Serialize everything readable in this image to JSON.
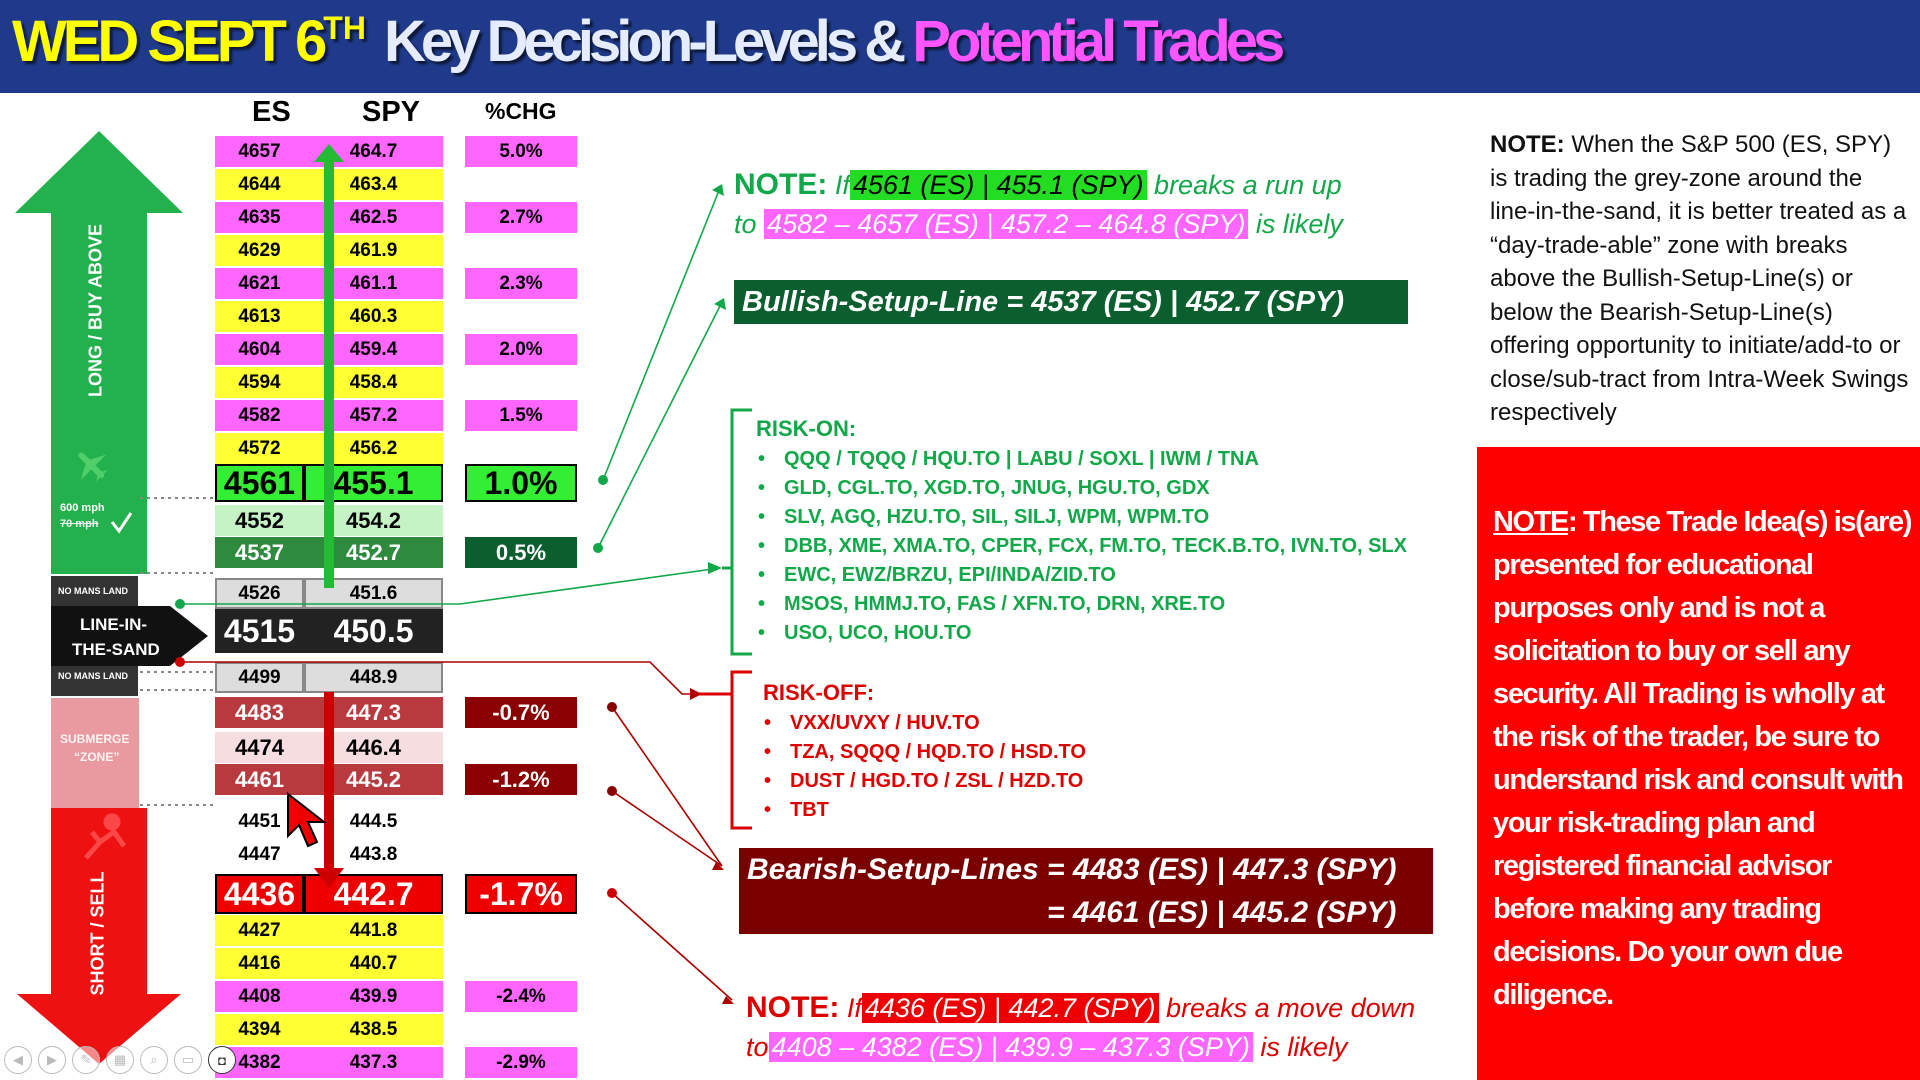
{
  "header": {
    "date": "WED SEPT 6",
    "date_suffix": "TH",
    "title_white": "Key Decision-Levels & ",
    "title_pink": "Potential Trades"
  },
  "columns": {
    "es": "ES",
    "spy": "SPY",
    "pct": "%CHG"
  },
  "rows": [
    {
      "es": "4657",
      "spy": "464.7",
      "pct": "5.0%"
    },
    {
      "es": "4644",
      "spy": "463.4",
      "pct": ""
    },
    {
      "es": "4635",
      "spy": "462.5",
      "pct": "2.7%"
    },
    {
      "es": "4629",
      "spy": "461.9",
      "pct": ""
    },
    {
      "es": "4621",
      "spy": "461.1",
      "pct": "2.3%"
    },
    {
      "es": "4613",
      "spy": "460.3",
      "pct": ""
    },
    {
      "es": "4604",
      "spy": "459.4",
      "pct": "2.0%"
    },
    {
      "es": "4594",
      "spy": "458.4",
      "pct": ""
    },
    {
      "es": "4582",
      "spy": "457.2",
      "pct": "1.5%"
    },
    {
      "es": "4572",
      "spy": "456.2",
      "pct": ""
    },
    {
      "es": "4561",
      "spy": "455.1",
      "pct": "1.0%"
    },
    {
      "es": "4552",
      "spy": "454.2",
      "pct": ""
    },
    {
      "es": "4537",
      "spy": "452.7",
      "pct": "0.5%"
    },
    {
      "es": "4526",
      "spy": "451.6",
      "pct": ""
    },
    {
      "es": "4515",
      "spy": "450.5",
      "pct": ""
    },
    {
      "es": "4499",
      "spy": "448.9",
      "pct": ""
    },
    {
      "es": "4483",
      "spy": "447.3",
      "pct": "-0.7%"
    },
    {
      "es": "4474",
      "spy": "446.4",
      "pct": ""
    },
    {
      "es": "4461",
      "spy": "445.2",
      "pct": "-1.2%"
    },
    {
      "es": "4451",
      "spy": "444.5",
      "pct": ""
    },
    {
      "es": "4447",
      "spy": "443.8",
      "pct": ""
    },
    {
      "es": "4436",
      "spy": "442.7",
      "pct": "-1.7%"
    },
    {
      "es": "4427",
      "spy": "441.8",
      "pct": ""
    },
    {
      "es": "4416",
      "spy": "440.7",
      "pct": ""
    },
    {
      "es": "4408",
      "spy": "439.9",
      "pct": "-2.4%"
    },
    {
      "es": "4394",
      "spy": "438.5",
      "pct": ""
    },
    {
      "es": "4382",
      "spy": "437.3",
      "pct": "-2.9%"
    }
  ],
  "side": {
    "long_label": "LONG / BUY ABOVE",
    "short_label": "SHORT / SELL",
    "speed_new": "600 mph",
    "speed_old": "70 mph",
    "no_mans_land": "NO MANS LAND",
    "line_in_sand_1": "LINE-IN-",
    "line_in_sand_2": "THE-SAND",
    "submerge_1": "SUBMERGE",
    "submerge_2": "“ZONE”"
  },
  "bull_note": {
    "label": "NOTE:",
    "if": "If",
    "level": "4561 (ES) | 455.1 (SPY)",
    "mid": "breaks a run up",
    "to": "to",
    "range": "4582 – 4657 (ES) | 457.2 – 464.8 (SPY)",
    "end": "is likely"
  },
  "bullish_setup": "Bullish-Setup-Line = 4537 (ES) | 452.7   (SPY)",
  "risk_on": {
    "title": "RISK-ON:",
    "items": [
      "QQQ / TQQQ / HQU.TO  |  LABU / SOXL | IWM / TNA",
      "GLD, CGL.TO, XGD.TO, JNUG, HGU.TO, GDX",
      "SLV, AGQ, HZU.TO, SIL, SILJ, WPM, WPM.TO",
      "DBB, XME, XMA.TO, CPER, FCX, FM.TO, TECK.B.TO, IVN.TO, SLX",
      "EWC, EWZ/BRZU, EPI/INDA/ZID.TO",
      "MSOS, HMMJ.TO, FAS / XFN.TO, DRN, XRE.TO",
      "USO, UCO, HOU.TO"
    ]
  },
  "risk_off": {
    "title": "RISK-OFF:",
    "items": [
      "VXX/UVXY / HUV.TO",
      "TZA, SQQQ / HQD.TO / HSD.TO",
      "DUST / HGD.TO / ZSL / HZD.TO",
      "TBT"
    ]
  },
  "bearish_setup": {
    "line1": "Bearish-Setup-Lines = 4483 (ES) | 447.3 (SPY)",
    "line2": "= 4461 (ES) | 445.2  (SPY)"
  },
  "bear_note": {
    "label": "NOTE:",
    "if": "If",
    "level": "4436 (ES) | 442.7 (SPY)",
    "mid": "breaks a move down",
    "to": "to",
    "range": "4408 – 4382 (ES) | 439.9 – 437.3 (SPY)",
    "end": "is likely"
  },
  "right_note": {
    "label": "NOTE:",
    "text": "When the S&P 500 (ES, SPY) is trading the grey-zone around the line-in-the-sand, it is better treated as a “day-trade-able” zone with breaks above the Bullish-Setup-Line(s) or below the Bearish-Setup-Line(s) offering opportunity to initiate/add-to or close/sub-tract from Intra-Week Swings respectively"
  },
  "disclaimer": {
    "label": "NOTE",
    "text": ": These Trade Idea(s) is(are) presented for educational purposes only and is not a solicitation to buy or sell any security. All Trading is wholly at the risk of the trader, be sure to understand risk and consult with your risk-trading plan and registered financial advisor before making any trading decisions. Do your own due diligence."
  },
  "colors": {
    "header_bg": "#1f3a8a",
    "date": "#ffff00",
    "pink": "#ff66ff",
    "yellow": "#ffff33",
    "green": "#22bb33",
    "dark_green": "#0b5e2e",
    "red": "#ee0000",
    "dark_red": "#7a0000",
    "risk_on": "#12a84a",
    "risk_off": "#dd0000"
  }
}
